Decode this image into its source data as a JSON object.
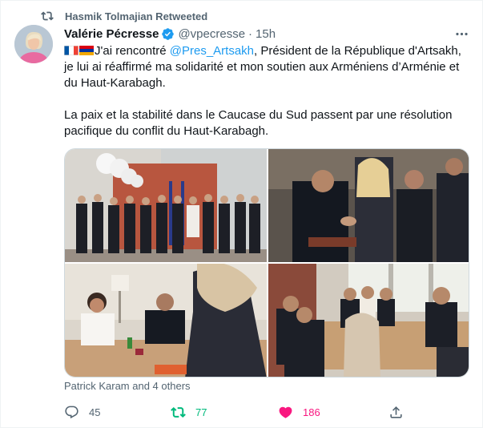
{
  "retweet_banner": {
    "text": "Hasmik Tolmajian Retweeted",
    "icon": "retweet-icon"
  },
  "tweet": {
    "author_name": "Valérie Pécresse",
    "handle": "@vpecresse",
    "separator": "·",
    "time": "15h",
    "verified": true,
    "text_part1": "J'ai rencontré ",
    "mention": "@Pres_Artsakh",
    "text_part2": ", Président de la République d'Artsakh, je lui ai réaffirmé ma solidarité et mon soutien aux Arméniens d’Arménie et du Haut-Karabagh.",
    "paragraph2": "La paix et la stabilité dans le Caucase du Sud passent par une résolution pacifique du conflit du Haut-Karabagh.",
    "flags": [
      "flag-france",
      "flag-armenia"
    ],
    "tagged": "Patrick Karam and 4 others"
  },
  "actions": {
    "reply_count": "45",
    "retweet_count": "77",
    "like_count": "186"
  },
  "colors": {
    "accent": "#1d9bf0",
    "retweeted": "#00ba7c",
    "liked": "#f91880",
    "muted": "#536471"
  }
}
